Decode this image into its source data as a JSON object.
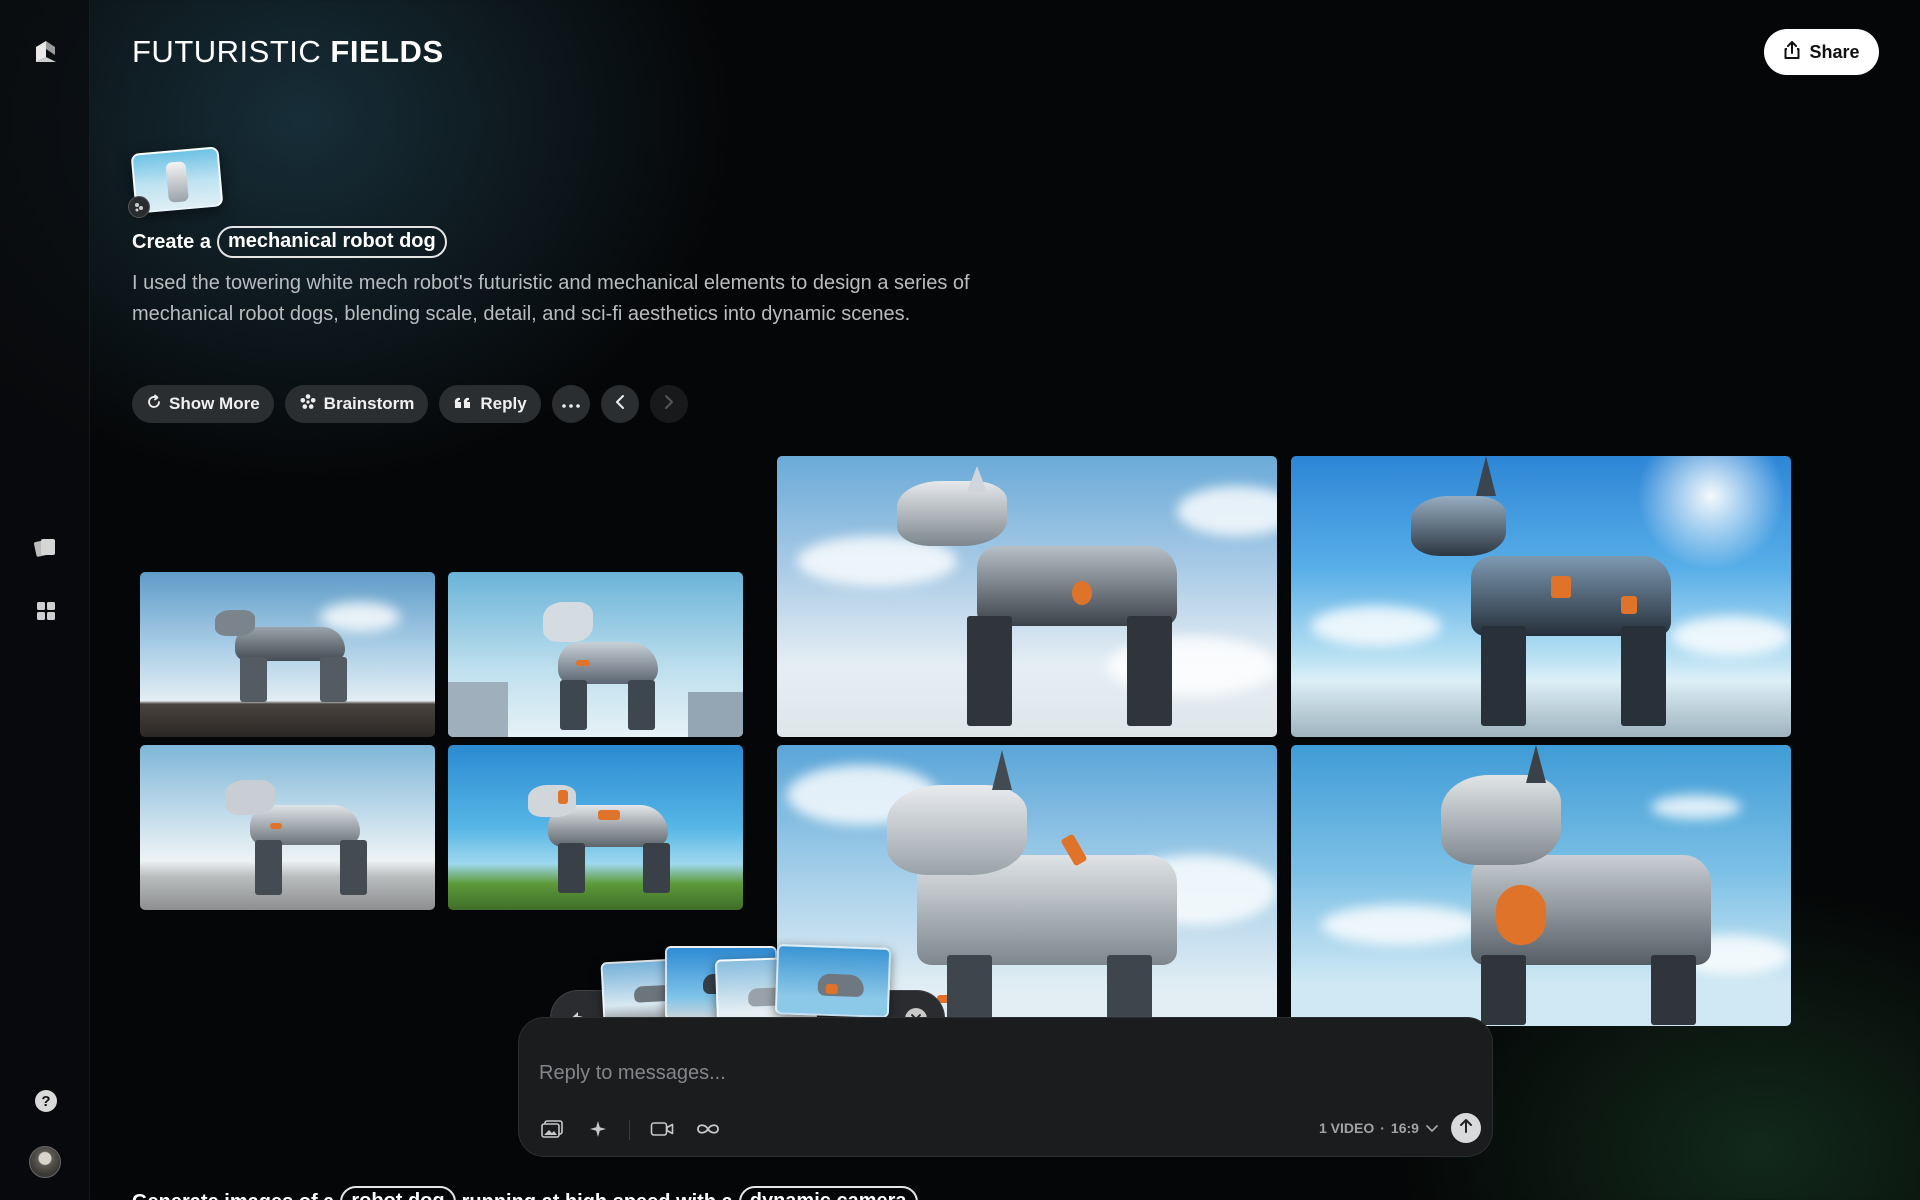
{
  "header": {
    "title_light": "FUTURISTIC",
    "title_bold": "FIELDS",
    "share_label": "Share"
  },
  "prompt": {
    "prefix": "Create a",
    "subject_chip": "mechanical robot dog",
    "description": "I used the towering white mech robot's futuristic and mechanical elements to design a series of mechanical robot dogs, blending scale, detail, and sci-fi aesthetics into dynamic scenes."
  },
  "actions": {
    "show_more_label": "Show More",
    "brainstorm_label": "Brainstorm",
    "reply_label": "Reply"
  },
  "sidebar": {
    "icons": [
      "logo-icon",
      "cards-icon",
      "grid-icon",
      "help-icon",
      "avatar"
    ]
  },
  "images": [
    {
      "name": "robot-dog-on-rock",
      "scene": "sky"
    },
    {
      "name": "robot-dog-city",
      "scene": "sky"
    },
    {
      "name": "robot-dog-dust",
      "scene": "sky"
    },
    {
      "name": "robot-dog-grass",
      "scene": "sky"
    },
    {
      "name": "robot-dog-clouds-large",
      "scene": "sky"
    },
    {
      "name": "robot-dog-sun-large",
      "scene": "sky"
    },
    {
      "name": "robot-dog-closeup-large",
      "scene": "sky"
    },
    {
      "name": "robot-dog-orange-large",
      "scene": "sky"
    }
  ],
  "composer": {
    "placeholder": "Reply to messages...",
    "video_count": "1 VIDEO",
    "separator": "·",
    "aspect_ratio": "16:9"
  },
  "next_prompt": {
    "prefix": "Generate images of a",
    "chip_1": "robot dog",
    "middle": "running at high speed with a",
    "chip_2": "dynamic camera"
  },
  "colors": {
    "background": "#050607",
    "accent_orange": "#e0732a",
    "pill_bg": "#2b2e31"
  }
}
